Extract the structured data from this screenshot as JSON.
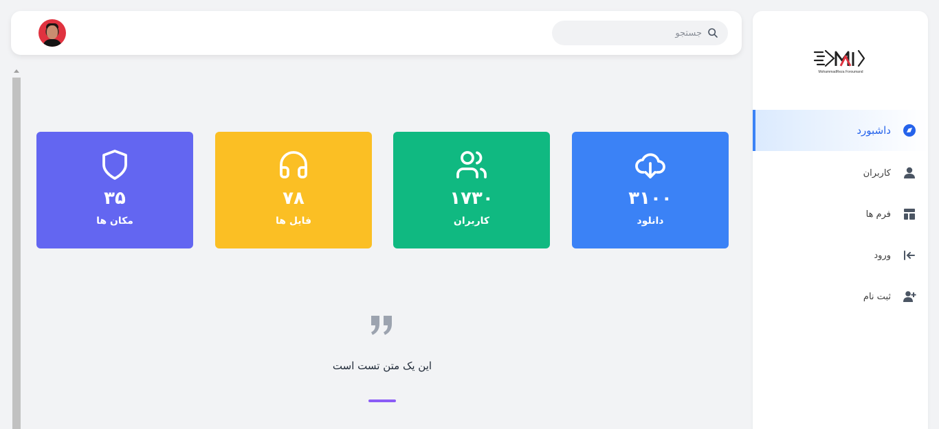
{
  "header": {
    "search_placeholder": "جستجو",
    "avatar_alt": "avatar"
  },
  "sidebar": {
    "logo_text": "MohammadReza Foroumand",
    "items": [
      {
        "label": "داشبورد",
        "icon": "compass-icon",
        "active": true
      },
      {
        "label": "کاربران",
        "icon": "user-icon",
        "active": false
      },
      {
        "label": "فرم ها",
        "icon": "layout-icon",
        "active": false
      },
      {
        "label": "ورود",
        "icon": "login-icon",
        "active": false
      },
      {
        "label": "ثبت نام",
        "icon": "user-plus-icon",
        "active": false
      }
    ]
  },
  "cards": [
    {
      "value": "۳۱۰۰",
      "label": "دانلود",
      "icon": "cloud-download-icon",
      "color": "#3b82f6"
    },
    {
      "value": "۱۷۳۰",
      "label": "کاربران",
      "icon": "users-icon",
      "color": "#10b981"
    },
    {
      "value": "۷۸",
      "label": "فایل ها",
      "icon": "headphones-icon",
      "color": "#fbbf24"
    },
    {
      "value": "۳۵",
      "label": "مکان ها",
      "icon": "shield-icon",
      "color": "#6366f1"
    }
  ],
  "quote": {
    "text": "این یک متن تست است",
    "accent": "#8b5cf6"
  }
}
